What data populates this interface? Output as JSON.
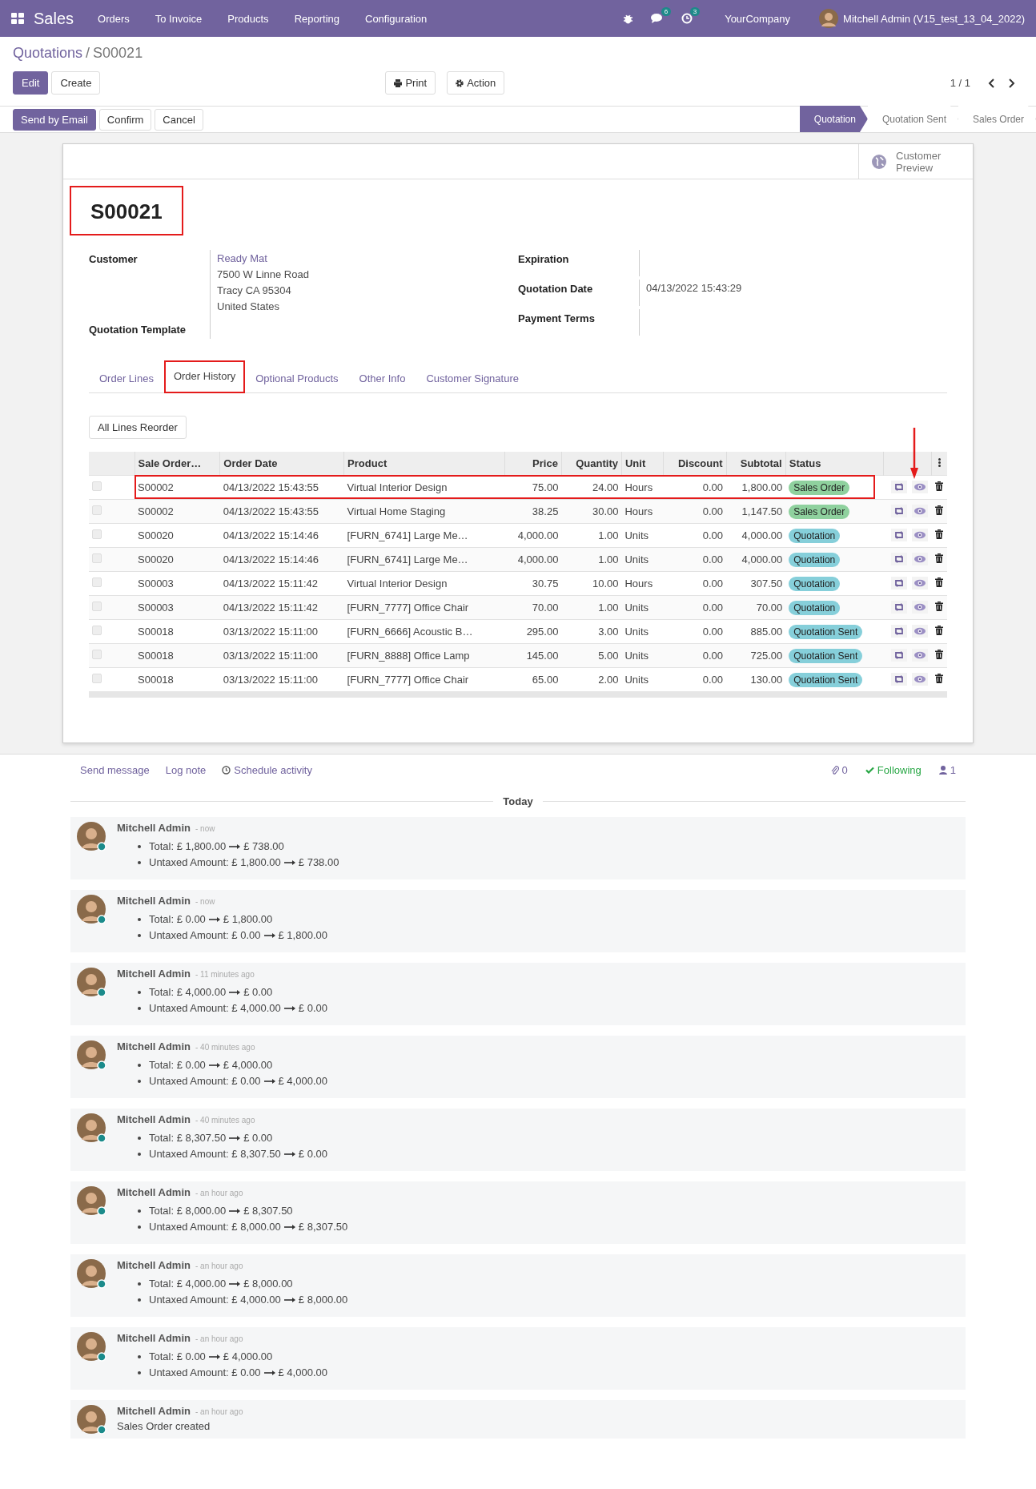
{
  "navbar": {
    "app": "Sales",
    "menu": [
      "Orders",
      "To Invoice",
      "Products",
      "Reporting",
      "Configuration"
    ],
    "messages_badge": "6",
    "activities_badge": "3",
    "company": "YourCompany",
    "user": "Mitchell Admin (V15_test_13_04_2022)"
  },
  "breadcrumb": {
    "parent": "Quotations",
    "separator": "/",
    "current": "S00021"
  },
  "buttons": {
    "edit": "Edit",
    "create": "Create",
    "print": "Print",
    "action": "Action",
    "pager": "1 / 1"
  },
  "header_buttons": [
    {
      "label": "Send by Email",
      "primary": true
    },
    {
      "label": "Confirm",
      "primary": false
    },
    {
      "label": "Cancel",
      "primary": false
    }
  ],
  "stages": [
    {
      "label": "Quotation",
      "selected": true
    },
    {
      "label": "Quotation Sent",
      "selected": false
    },
    {
      "label": "Sales Order",
      "selected": false
    }
  ],
  "customer_preview": "Customer Preview",
  "title": {
    "text": "S00021",
    "highlighted": true
  },
  "fields_left": [
    {
      "label": "Customer",
      "lines": [
        "Ready Mat",
        "7500 W Linne Road",
        "Tracy CA 95304",
        "United States"
      ]
    },
    {
      "label": "Quotation Template"
    }
  ],
  "fields_right": [
    {
      "label": "Expiration"
    },
    {
      "label": "Quotation Date",
      "value": "04/13/2022 15:43:29"
    },
    {
      "label": "Payment Terms"
    }
  ],
  "tabs": [
    {
      "label": "Order Lines",
      "selected": false,
      "highlighted": false
    },
    {
      "label": "Order History",
      "selected": true,
      "highlighted": true
    },
    {
      "label": "Optional Products",
      "selected": false,
      "highlighted": false
    },
    {
      "label": "Other Info",
      "selected": false,
      "highlighted": false
    },
    {
      "label": "Customer Signature",
      "selected": false,
      "highlighted": false
    }
  ],
  "reorder_button": "All Lines Reorder",
  "table": {
    "columns": [
      "Sale Order…",
      "Order Date",
      "Product",
      "Price",
      "Quantity",
      "Unit",
      "Discount",
      "Subtotal",
      "Status"
    ],
    "rows": [
      {
        "checked": false,
        "highlighted": true,
        "arrow": true,
        "cells": [
          "S00002",
          "04/13/2022 15:43:55",
          "Virtual Interior Design",
          "75.00",
          "24.00",
          "Hours",
          "0.00",
          "1,800.00"
        ],
        "status": "Sales Order",
        "color": "#8fd19e"
      },
      {
        "checked": false,
        "highlighted": false,
        "arrow": false,
        "cells": [
          "S00002",
          "04/13/2022 15:43:55",
          "Virtual Home Staging",
          "38.25",
          "30.00",
          "Hours",
          "0.00",
          "1,147.50"
        ],
        "status": "Sales Order",
        "color": "#8fd19e"
      },
      {
        "checked": false,
        "highlighted": false,
        "arrow": false,
        "cells": [
          "S00020",
          "04/13/2022 15:14:46",
          "[FURN_6741] Large Me…",
          "4,000.00",
          "1.00",
          "Units",
          "0.00",
          "4,000.00"
        ],
        "status": "Quotation",
        "color": "#86cfda"
      },
      {
        "checked": false,
        "highlighted": false,
        "arrow": false,
        "cells": [
          "S00020",
          "04/13/2022 15:14:46",
          "[FURN_6741] Large Me…",
          "4,000.00",
          "1.00",
          "Units",
          "0.00",
          "4,000.00"
        ],
        "status": "Quotation",
        "color": "#86cfda"
      },
      {
        "checked": false,
        "highlighted": false,
        "arrow": false,
        "cells": [
          "S00003",
          "04/13/2022 15:11:42",
          "Virtual Interior Design",
          "30.75",
          "10.00",
          "Hours",
          "0.00",
          "307.50"
        ],
        "status": "Quotation",
        "color": "#86cfda"
      },
      {
        "checked": false,
        "highlighted": false,
        "arrow": false,
        "cells": [
          "S00003",
          "04/13/2022 15:11:42",
          "[FURN_7777] Office Chair",
          "70.00",
          "1.00",
          "Units",
          "0.00",
          "70.00"
        ],
        "status": "Quotation",
        "color": "#86cfda"
      },
      {
        "checked": false,
        "highlighted": false,
        "arrow": false,
        "cells": [
          "S00018",
          "03/13/2022 15:11:00",
          "[FURN_6666] Acoustic B…",
          "295.00",
          "3.00",
          "Units",
          "0.00",
          "885.00"
        ],
        "status": "Quotation Sent",
        "color": "#86cfda"
      },
      {
        "checked": false,
        "highlighted": false,
        "arrow": false,
        "cells": [
          "S00018",
          "03/13/2022 15:11:00",
          "[FURN_8888] Office Lamp",
          "145.00",
          "5.00",
          "Units",
          "0.00",
          "725.00"
        ],
        "status": "Quotation Sent",
        "color": "#86cfda"
      },
      {
        "checked": false,
        "highlighted": false,
        "arrow": false,
        "cells": [
          "S00018",
          "03/13/2022 15:11:00",
          "[FURN_7777] Office Chair",
          "65.00",
          "2.00",
          "Units",
          "0.00",
          "130.00"
        ],
        "status": "Quotation Sent",
        "color": "#86cfda"
      }
    ]
  },
  "chatter": {
    "send_message": "Send message",
    "log_note": "Log note",
    "schedule": "Schedule activity",
    "attachments": "0",
    "following": "Following",
    "followers": "1",
    "date_separator": "Today",
    "messages": [
      {
        "kind": "tracking",
        "author": "Mitchell Admin",
        "time": "- now",
        "changes": [
          {
            "field": "Total:",
            "old": "£ 1,800.00",
            "new": "£ 738.00"
          },
          {
            "field": "Untaxed Amount:",
            "old": "£ 1,800.00",
            "new": "£ 738.00"
          }
        ]
      },
      {
        "kind": "tracking",
        "author": "Mitchell Admin",
        "time": "- now",
        "changes": [
          {
            "field": "Total:",
            "old": "£ 0.00",
            "new": "£ 1,800.00"
          },
          {
            "field": "Untaxed Amount:",
            "old": "£ 0.00",
            "new": "£ 1,800.00"
          }
        ]
      },
      {
        "kind": "tracking",
        "author": "Mitchell Admin",
        "time": "- 11 minutes ago",
        "changes": [
          {
            "field": "Total:",
            "old": "£ 4,000.00",
            "new": "£ 0.00"
          },
          {
            "field": "Untaxed Amount:",
            "old": "£ 4,000.00",
            "new": "£ 0.00"
          }
        ]
      },
      {
        "kind": "tracking",
        "author": "Mitchell Admin",
        "time": "- 40 minutes ago",
        "changes": [
          {
            "field": "Total:",
            "old": "£ 0.00",
            "new": "£ 4,000.00"
          },
          {
            "field": "Untaxed Amount:",
            "old": "£ 0.00",
            "new": "£ 4,000.00"
          }
        ]
      },
      {
        "kind": "tracking",
        "author": "Mitchell Admin",
        "time": "- 40 minutes ago",
        "changes": [
          {
            "field": "Total:",
            "old": "£ 8,307.50",
            "new": "£ 0.00"
          },
          {
            "field": "Untaxed Amount:",
            "old": "£ 8,307.50",
            "new": "£ 0.00"
          }
        ]
      },
      {
        "kind": "tracking",
        "author": "Mitchell Admin",
        "time": "- an hour ago",
        "changes": [
          {
            "field": "Total:",
            "old": "£ 8,000.00",
            "new": "£ 8,307.50"
          },
          {
            "field": "Untaxed Amount:",
            "old": "£ 8,000.00",
            "new": "£ 8,307.50"
          }
        ]
      },
      {
        "kind": "tracking",
        "author": "Mitchell Admin",
        "time": "- an hour ago",
        "changes": [
          {
            "field": "Total:",
            "old": "£ 4,000.00",
            "new": "£ 8,000.00"
          },
          {
            "field": "Untaxed Amount:",
            "old": "£ 4,000.00",
            "new": "£ 8,000.00"
          }
        ]
      },
      {
        "kind": "tracking",
        "author": "Mitchell Admin",
        "time": "- an hour ago",
        "changes": [
          {
            "field": "Total:",
            "old": "£ 0.00",
            "new": "£ 4,000.00"
          },
          {
            "field": "Untaxed Amount:",
            "old": "£ 0.00",
            "new": "£ 4,000.00"
          }
        ]
      },
      {
        "kind": "note",
        "author": "Mitchell Admin",
        "time": "- an hour ago",
        "body": "Sales Order created"
      }
    ]
  }
}
